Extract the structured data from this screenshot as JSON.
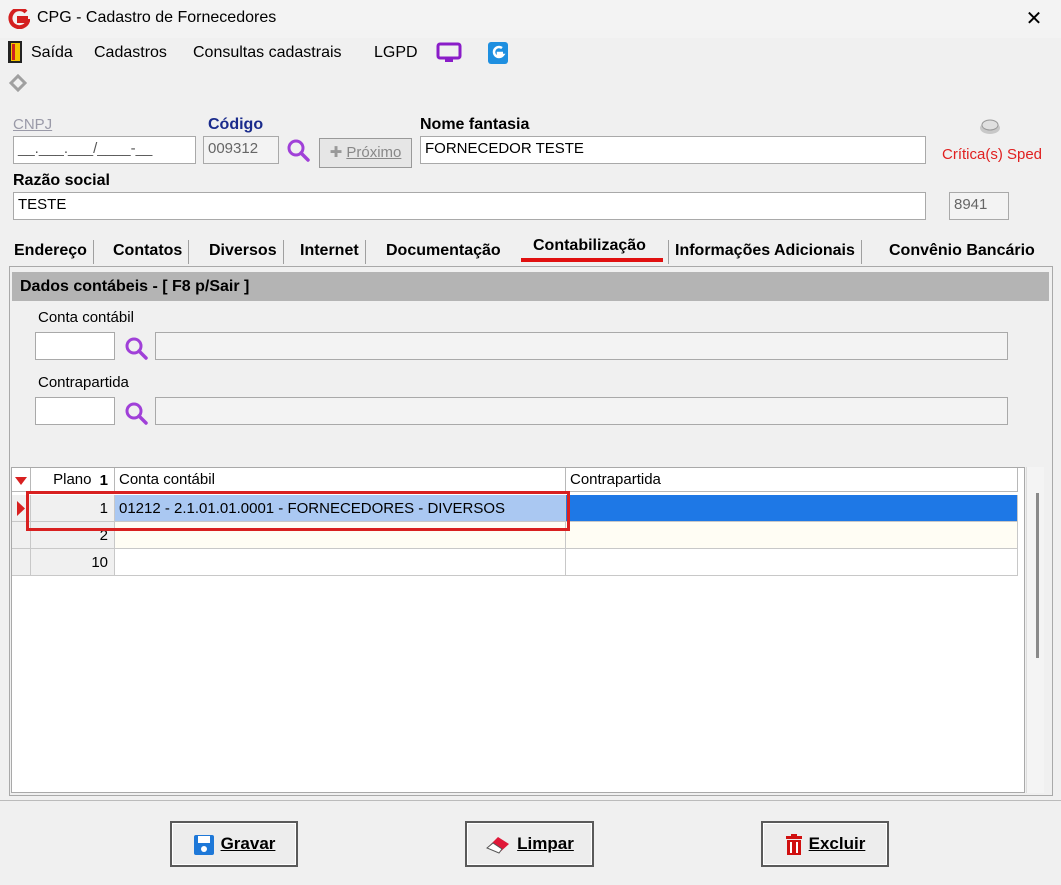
{
  "window": {
    "title": "CPG - Cadastro de Fornecedores"
  },
  "menu": {
    "exit": "Saída",
    "cadastros": "Cadastros",
    "consultas": "Consultas cadastrais",
    "lgpd": "LGPD"
  },
  "form": {
    "cnpj_label": "CNPJ",
    "cnpj_value": "__.___.___/____-__",
    "codigo_label": "Código",
    "codigo_value": "009312",
    "proximo_label": "Próximo",
    "nome_fantasia_label": "Nome fantasia",
    "nome_fantasia_value": "FORNECEDOR TESTE",
    "critica_label": "Crítica(s) Sped",
    "razao_social_label": "Razão social",
    "razao_social_value": "TESTE",
    "side_value": "8941"
  },
  "tabs": [
    {
      "label": "Endereço"
    },
    {
      "label": "Contatos"
    },
    {
      "label": "Diversos"
    },
    {
      "label": "Internet"
    },
    {
      "label": "Documentação"
    },
    {
      "label": "Contabilização",
      "active": true
    },
    {
      "label": "Informações Adicionais"
    },
    {
      "label": "Convênio Bancário"
    }
  ],
  "panel": {
    "header": "Dados contábeis - [ F8 p/Sair ]",
    "conta_contabil_label": "Conta contábil",
    "contrapartida_label": "Contrapartida"
  },
  "grid": {
    "columns": [
      "Plano",
      "Conta contábil",
      "Contrapartida"
    ],
    "sort_indicator": "1",
    "rows": [
      {
        "plano": "1",
        "conta": "01212 - 2.1.01.01.0001 - FORNECEDORES - DIVERSOS",
        "contrapartida": ""
      },
      {
        "plano": "2",
        "conta": "",
        "contrapartida": ""
      },
      {
        "plano": "10",
        "conta": "",
        "contrapartida": ""
      }
    ]
  },
  "buttons": {
    "gravar": "Gravar",
    "limpar": "Limpar",
    "excluir": "Excluir"
  },
  "colors": {
    "accent_red": "#e01010",
    "selection_blue": "#1e78e6",
    "label_blue": "#1a2b8c"
  }
}
